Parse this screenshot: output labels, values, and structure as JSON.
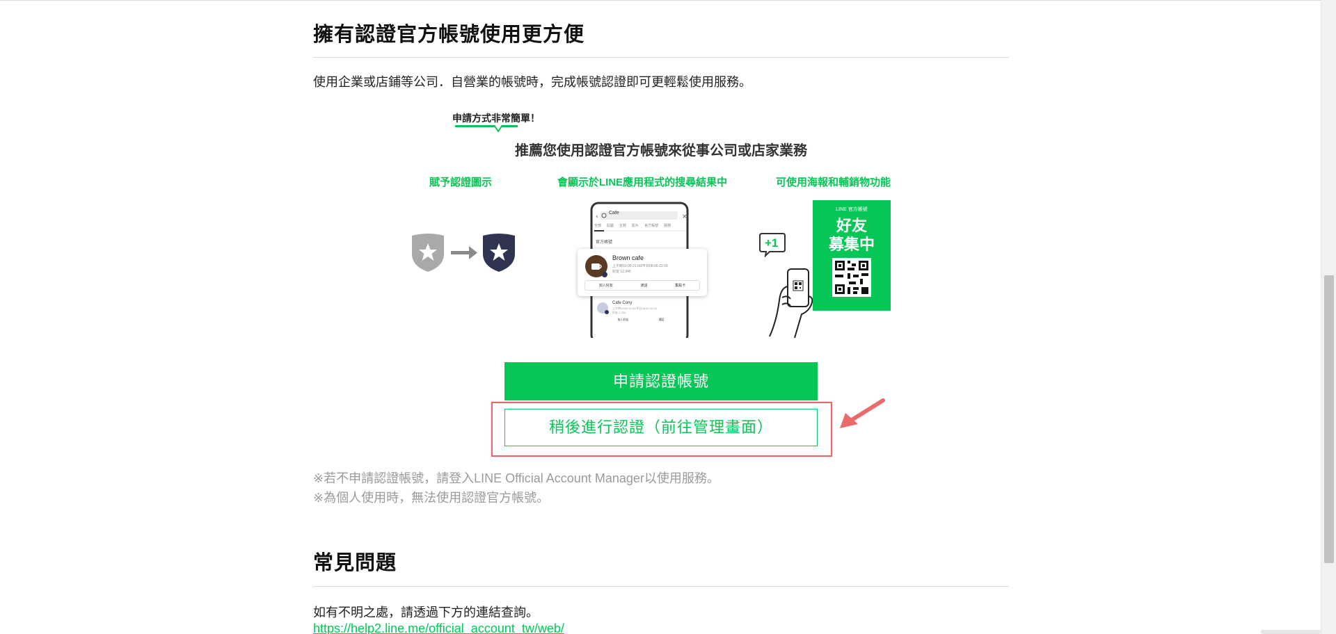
{
  "section": {
    "title": "擁有認證官方帳號使用更方便",
    "description": "使用企業或店鋪等公司．自營業的帳號時，完成帳號認證即可更輕鬆使用服務。"
  },
  "illustration": {
    "bubble": "申請方式非常簡單！",
    "headline": "推薦您使用認證官方帳號來從事公司或店家業務",
    "features": [
      "賦予認證圖示",
      "會顯示於LINE應用程式的搜尋結果中",
      "可使用海報和輔銷物功能"
    ],
    "phone": {
      "search_text": "Cafe",
      "tabs": [
        "全部",
        "貼圖",
        "主題",
        "影片",
        "官方帳號",
        "服務"
      ],
      "section_label": "官方帳號",
      "result_name": "Brown cafe",
      "result_detail": "上午時10:00-21:00/平日08:00-22:00",
      "result_friends": "好友 12,345",
      "actions": [
        "加入好友",
        "通話",
        "集點卡"
      ],
      "result2_name": "Cafe Cony",
      "result2_detail": "上午時10:00-21:00/平日08:00-22:00",
      "result2_friends": "好友 1,234",
      "actions2": [
        "加入好友",
        "通話"
      ]
    },
    "plus_one": "+1",
    "poster": {
      "header": "LINE 官方帳號",
      "line1": "好友",
      "line2": "募集中"
    }
  },
  "buttons": {
    "apply": "申請認證帳號",
    "later": "稍後進行認證（前往管理畫面）"
  },
  "notes": [
    "※若不申請認證帳號，請登入LINE Official Account Manager以使用服務。",
    "※為個人使用時，無法使用認證官方帳號。"
  ],
  "faq": {
    "title": "常見問題",
    "description": "如有不明之處，請透過下方的連結查詢。",
    "link": "https://help2.line.me/official_account_tw/web/"
  },
  "colors": {
    "brand_green": "#06c755",
    "highlight_red": "#e46a6a",
    "navy_shield": "#2f3450"
  }
}
